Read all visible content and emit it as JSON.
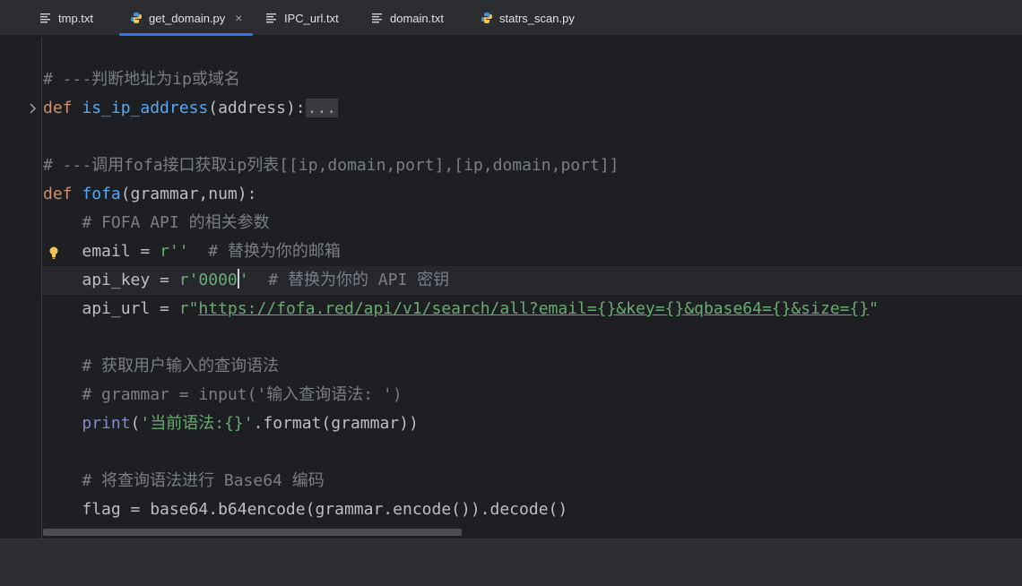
{
  "tabs": [
    {
      "label": "tmp.txt",
      "icon": "text-file-icon",
      "active": false
    },
    {
      "label": "get_domain.py",
      "icon": "python-file-icon",
      "active": true
    },
    {
      "label": "IPC_url.txt",
      "icon": "text-file-icon",
      "active": false
    },
    {
      "label": "domain.txt",
      "icon": "text-file-icon",
      "active": false
    },
    {
      "label": "statrs_scan.py",
      "icon": "python-file-icon",
      "active": false
    }
  ],
  "tab_close_symbol": "×",
  "colors": {
    "accent": "#3574f0",
    "keyword": "#cf8e6d",
    "function": "#56a8f5",
    "string": "#6aab73",
    "comment": "#7a7e85",
    "builtin": "#8888c6",
    "editor_bg": "#1e1f22"
  },
  "code": {
    "l1_comment": "# ---判断地址为ip或域名",
    "l2_def": "def",
    "l2_name": "is_ip_address",
    "l2_params": "(address):",
    "l2_folded": "...",
    "l4_comment": "# ---调用fofa接口获取ip列表[[ip,domain,port],[ip,domain,port]]",
    "l5_def": "def",
    "l5_name": "fofa",
    "l5_params": "(grammar,num):",
    "l6_comment": "# FOFA API 的相关参数",
    "l7_var": "email = ",
    "l7_str": "r''",
    "l7_comment": "  # 替换为你的邮箱",
    "l8_var": "api_key = ",
    "l8_str_a": "r'0000",
    "l8_str_b": "'",
    "l8_comment": "  # 替换为你的 API 密钥",
    "l9_var": "api_url = ",
    "l9_prefix": "r\"",
    "l9_url": "https://fofa.red/api/v1/search/all?email={}&key={}&qbase64={}&size={}",
    "l9_suffix": "\"",
    "l11_comment": "# 获取用户输入的查询语法",
    "l12_comment": "# grammar = input('输入查询语法: ')",
    "l13_builtin": "print",
    "l13_open": "(",
    "l13_str": "'当前语法:{}'",
    "l13_rest": ".format(grammar))",
    "l15_comment": "# 将查询语法进行 Base64 编码",
    "l16_code": "flag = base64.b64encode(grammar.encode()).decode()"
  }
}
